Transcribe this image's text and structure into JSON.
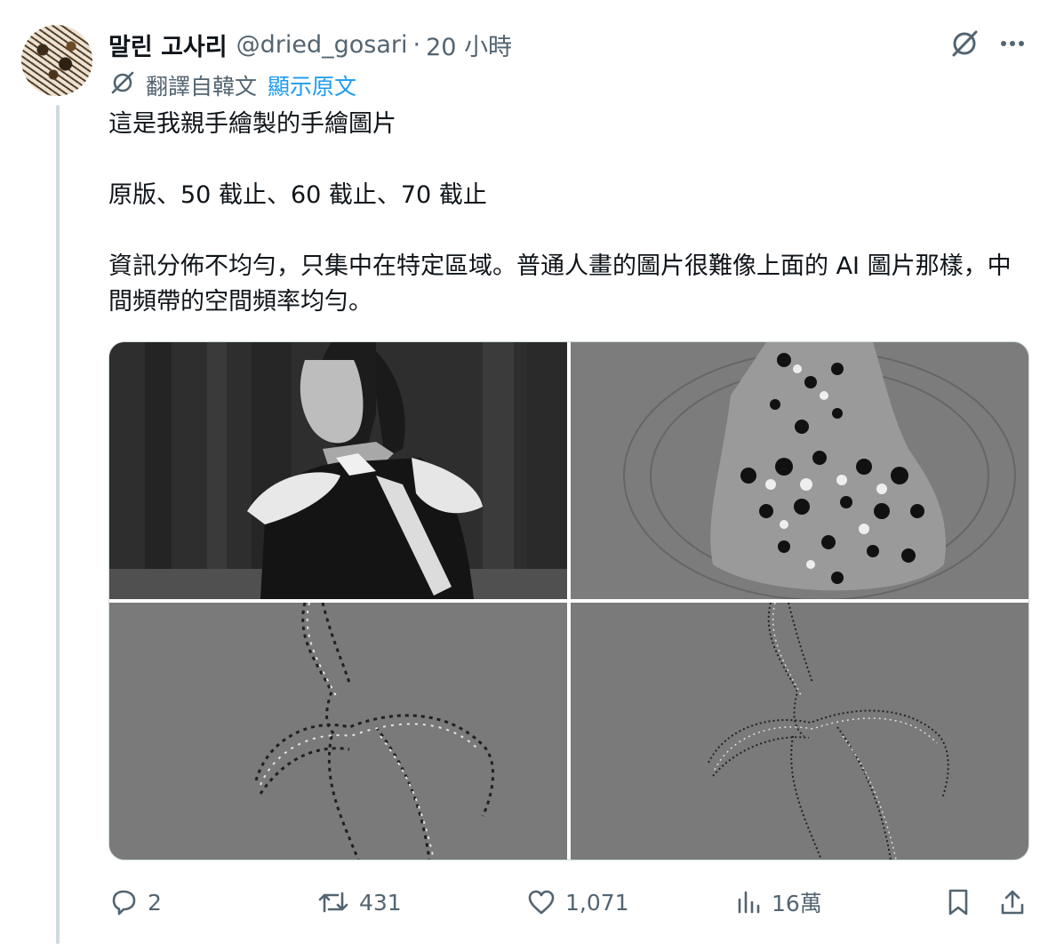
{
  "tweet": {
    "display_name": "말린 고사리",
    "handle": "@dried_gosari",
    "separator": "·",
    "time": "20 小時",
    "translation": {
      "label": "翻譯自韓文",
      "link": "顯示原文"
    },
    "paragraphs": [
      "這是我親手繪製的手繪圖片",
      "原版、50 截止、60 截止、70 截止",
      "資訊分佈不均勻，只集中在特定區域。普通人畫的圖片很難像上面的 AI 圖片那樣，中間頻帶的空間頻率均勻。"
    ]
  },
  "media": {
    "count": 4,
    "panels": [
      "original",
      "cutoff-50",
      "cutoff-60",
      "cutoff-70"
    ]
  },
  "actions": {
    "replies": "2",
    "retweets": "431",
    "likes": "1,071",
    "views": "16萬"
  },
  "icons": {
    "grok": "grok-icon",
    "more": "more-icon",
    "translate": "translate-icon",
    "reply": "reply-icon",
    "retweet": "retweet-icon",
    "like": "like-icon",
    "views": "views-icon",
    "bookmark": "bookmark-icon",
    "share": "share-icon"
  },
  "colors": {
    "text": "#0f1419",
    "secondary": "#536471",
    "link": "#1d9bf0",
    "border": "#cfd9de"
  }
}
